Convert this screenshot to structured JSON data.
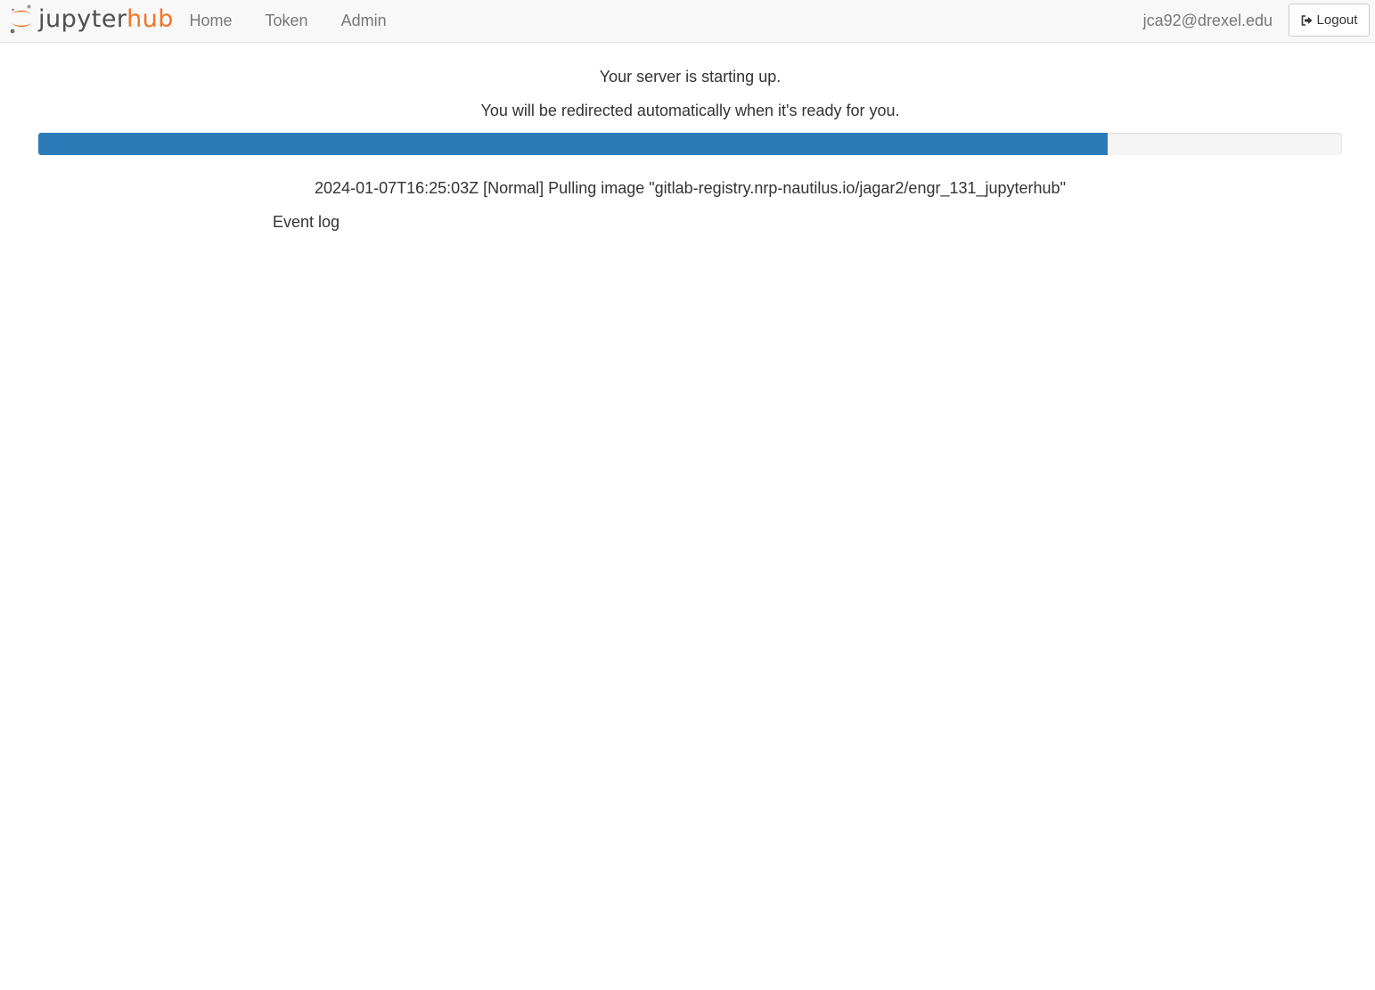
{
  "brand": {
    "name_part1": "jupyter",
    "name_part2": "hub",
    "accent_color": "#f37626",
    "icon": "jupyter-logo-icon"
  },
  "nav": {
    "items": [
      {
        "label": "Home"
      },
      {
        "label": "Token"
      },
      {
        "label": "Admin"
      }
    ]
  },
  "user": {
    "name": "jca92@drexel.edu",
    "logout_label": "Logout",
    "logout_icon": "sign-out-icon"
  },
  "main": {
    "status_line": "Your server is starting up.",
    "redirect_line": "You will be redirected automatically when it's ready for you.",
    "progress_percent": 82,
    "progress_color": "#2c7bb9",
    "progress_message": "2024-01-07T16:25:03Z [Normal] Pulling image \"gitlab-registry.nrp-nautilus.io/jagar2/engr_131_jupyterhub\"",
    "event_log_label": "Event log"
  }
}
